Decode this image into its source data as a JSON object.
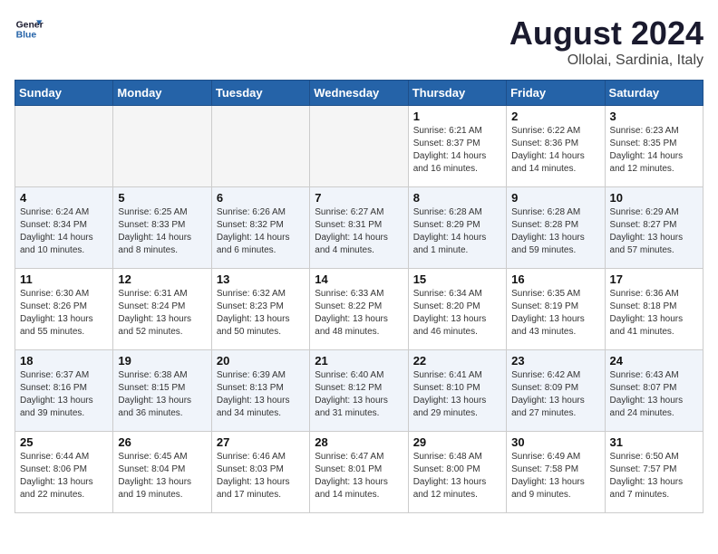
{
  "header": {
    "logo_line1": "General",
    "logo_line2": "Blue",
    "title": "August 2024",
    "subtitle": "Ollolai, Sardinia, Italy"
  },
  "weekdays": [
    "Sunday",
    "Monday",
    "Tuesday",
    "Wednesday",
    "Thursday",
    "Friday",
    "Saturday"
  ],
  "weeks": [
    [
      {
        "day": "",
        "info": "",
        "empty": true
      },
      {
        "day": "",
        "info": "",
        "empty": true
      },
      {
        "day": "",
        "info": "",
        "empty": true
      },
      {
        "day": "",
        "info": "",
        "empty": true
      },
      {
        "day": "1",
        "info": "Sunrise: 6:21 AM\nSunset: 8:37 PM\nDaylight: 14 hours\nand 16 minutes.",
        "empty": false
      },
      {
        "day": "2",
        "info": "Sunrise: 6:22 AM\nSunset: 8:36 PM\nDaylight: 14 hours\nand 14 minutes.",
        "empty": false
      },
      {
        "day": "3",
        "info": "Sunrise: 6:23 AM\nSunset: 8:35 PM\nDaylight: 14 hours\nand 12 minutes.",
        "empty": false
      }
    ],
    [
      {
        "day": "4",
        "info": "Sunrise: 6:24 AM\nSunset: 8:34 PM\nDaylight: 14 hours\nand 10 minutes.",
        "empty": false
      },
      {
        "day": "5",
        "info": "Sunrise: 6:25 AM\nSunset: 8:33 PM\nDaylight: 14 hours\nand 8 minutes.",
        "empty": false
      },
      {
        "day": "6",
        "info": "Sunrise: 6:26 AM\nSunset: 8:32 PM\nDaylight: 14 hours\nand 6 minutes.",
        "empty": false
      },
      {
        "day": "7",
        "info": "Sunrise: 6:27 AM\nSunset: 8:31 PM\nDaylight: 14 hours\nand 4 minutes.",
        "empty": false
      },
      {
        "day": "8",
        "info": "Sunrise: 6:28 AM\nSunset: 8:29 PM\nDaylight: 14 hours\nand 1 minute.",
        "empty": false
      },
      {
        "day": "9",
        "info": "Sunrise: 6:28 AM\nSunset: 8:28 PM\nDaylight: 13 hours\nand 59 minutes.",
        "empty": false
      },
      {
        "day": "10",
        "info": "Sunrise: 6:29 AM\nSunset: 8:27 PM\nDaylight: 13 hours\nand 57 minutes.",
        "empty": false
      }
    ],
    [
      {
        "day": "11",
        "info": "Sunrise: 6:30 AM\nSunset: 8:26 PM\nDaylight: 13 hours\nand 55 minutes.",
        "empty": false
      },
      {
        "day": "12",
        "info": "Sunrise: 6:31 AM\nSunset: 8:24 PM\nDaylight: 13 hours\nand 52 minutes.",
        "empty": false
      },
      {
        "day": "13",
        "info": "Sunrise: 6:32 AM\nSunset: 8:23 PM\nDaylight: 13 hours\nand 50 minutes.",
        "empty": false
      },
      {
        "day": "14",
        "info": "Sunrise: 6:33 AM\nSunset: 8:22 PM\nDaylight: 13 hours\nand 48 minutes.",
        "empty": false
      },
      {
        "day": "15",
        "info": "Sunrise: 6:34 AM\nSunset: 8:20 PM\nDaylight: 13 hours\nand 46 minutes.",
        "empty": false
      },
      {
        "day": "16",
        "info": "Sunrise: 6:35 AM\nSunset: 8:19 PM\nDaylight: 13 hours\nand 43 minutes.",
        "empty": false
      },
      {
        "day": "17",
        "info": "Sunrise: 6:36 AM\nSunset: 8:18 PM\nDaylight: 13 hours\nand 41 minutes.",
        "empty": false
      }
    ],
    [
      {
        "day": "18",
        "info": "Sunrise: 6:37 AM\nSunset: 8:16 PM\nDaylight: 13 hours\nand 39 minutes.",
        "empty": false
      },
      {
        "day": "19",
        "info": "Sunrise: 6:38 AM\nSunset: 8:15 PM\nDaylight: 13 hours\nand 36 minutes.",
        "empty": false
      },
      {
        "day": "20",
        "info": "Sunrise: 6:39 AM\nSunset: 8:13 PM\nDaylight: 13 hours\nand 34 minutes.",
        "empty": false
      },
      {
        "day": "21",
        "info": "Sunrise: 6:40 AM\nSunset: 8:12 PM\nDaylight: 13 hours\nand 31 minutes.",
        "empty": false
      },
      {
        "day": "22",
        "info": "Sunrise: 6:41 AM\nSunset: 8:10 PM\nDaylight: 13 hours\nand 29 minutes.",
        "empty": false
      },
      {
        "day": "23",
        "info": "Sunrise: 6:42 AM\nSunset: 8:09 PM\nDaylight: 13 hours\nand 27 minutes.",
        "empty": false
      },
      {
        "day": "24",
        "info": "Sunrise: 6:43 AM\nSunset: 8:07 PM\nDaylight: 13 hours\nand 24 minutes.",
        "empty": false
      }
    ],
    [
      {
        "day": "25",
        "info": "Sunrise: 6:44 AM\nSunset: 8:06 PM\nDaylight: 13 hours\nand 22 minutes.",
        "empty": false
      },
      {
        "day": "26",
        "info": "Sunrise: 6:45 AM\nSunset: 8:04 PM\nDaylight: 13 hours\nand 19 minutes.",
        "empty": false
      },
      {
        "day": "27",
        "info": "Sunrise: 6:46 AM\nSunset: 8:03 PM\nDaylight: 13 hours\nand 17 minutes.",
        "empty": false
      },
      {
        "day": "28",
        "info": "Sunrise: 6:47 AM\nSunset: 8:01 PM\nDaylight: 13 hours\nand 14 minutes.",
        "empty": false
      },
      {
        "day": "29",
        "info": "Sunrise: 6:48 AM\nSunset: 8:00 PM\nDaylight: 13 hours\nand 12 minutes.",
        "empty": false
      },
      {
        "day": "30",
        "info": "Sunrise: 6:49 AM\nSunset: 7:58 PM\nDaylight: 13 hours\nand 9 minutes.",
        "empty": false
      },
      {
        "day": "31",
        "info": "Sunrise: 6:50 AM\nSunset: 7:57 PM\nDaylight: 13 hours\nand 7 minutes.",
        "empty": false
      }
    ]
  ]
}
